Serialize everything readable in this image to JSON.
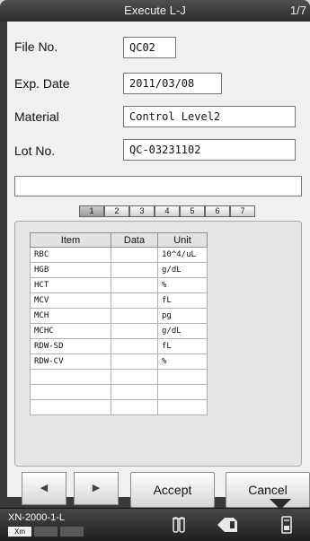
{
  "window": {
    "title": "Execute L-J",
    "page_indicator": "1/7"
  },
  "form": {
    "file_no": {
      "label": "File No.",
      "value": "QC02"
    },
    "exp_date": {
      "label": "Exp. Date",
      "value": "2011/03/08"
    },
    "material": {
      "label": "Material",
      "value": "Control Level2"
    },
    "lot_no": {
      "label": "Lot No.",
      "value": "QC-03231102"
    }
  },
  "message": "",
  "page_tabs": [
    "1",
    "2",
    "3",
    "4",
    "5",
    "6",
    "7"
  ],
  "active_page": "1",
  "table": {
    "headers": {
      "item": "Item",
      "data": "Data",
      "unit": "Unit"
    },
    "rows": [
      {
        "item": "RBC",
        "data": "",
        "unit": "10^4/uL"
      },
      {
        "item": "HGB",
        "data": "",
        "unit": "g/dL"
      },
      {
        "item": "HCT",
        "data": "",
        "unit": "%"
      },
      {
        "item": "MCV",
        "data": "",
        "unit": "fL"
      },
      {
        "item": "MCH",
        "data": "",
        "unit": "pg"
      },
      {
        "item": "MCHC",
        "data": "",
        "unit": "g/dL"
      },
      {
        "item": "RDW-SD",
        "data": "",
        "unit": "fL"
      },
      {
        "item": "RDW-CV",
        "data": "",
        "unit": "%"
      },
      {
        "item": "",
        "data": "",
        "unit": ""
      },
      {
        "item": "",
        "data": "",
        "unit": ""
      },
      {
        "item": "",
        "data": "",
        "unit": ""
      }
    ]
  },
  "buttons": {
    "prev": "◀",
    "next": "▶",
    "accept": "Accept",
    "cancel": "Cancel"
  },
  "status_bar": {
    "device": "XN-2000-1-L",
    "badges": [
      "Xm",
      "",
      ""
    ],
    "icons": [
      "sample-tube-icon",
      "analyzer-icon",
      "device-icon"
    ]
  },
  "colors": {
    "title_bar": "#2b2b2b",
    "panel": "#f0f0f0",
    "status_bar": "#333333"
  }
}
